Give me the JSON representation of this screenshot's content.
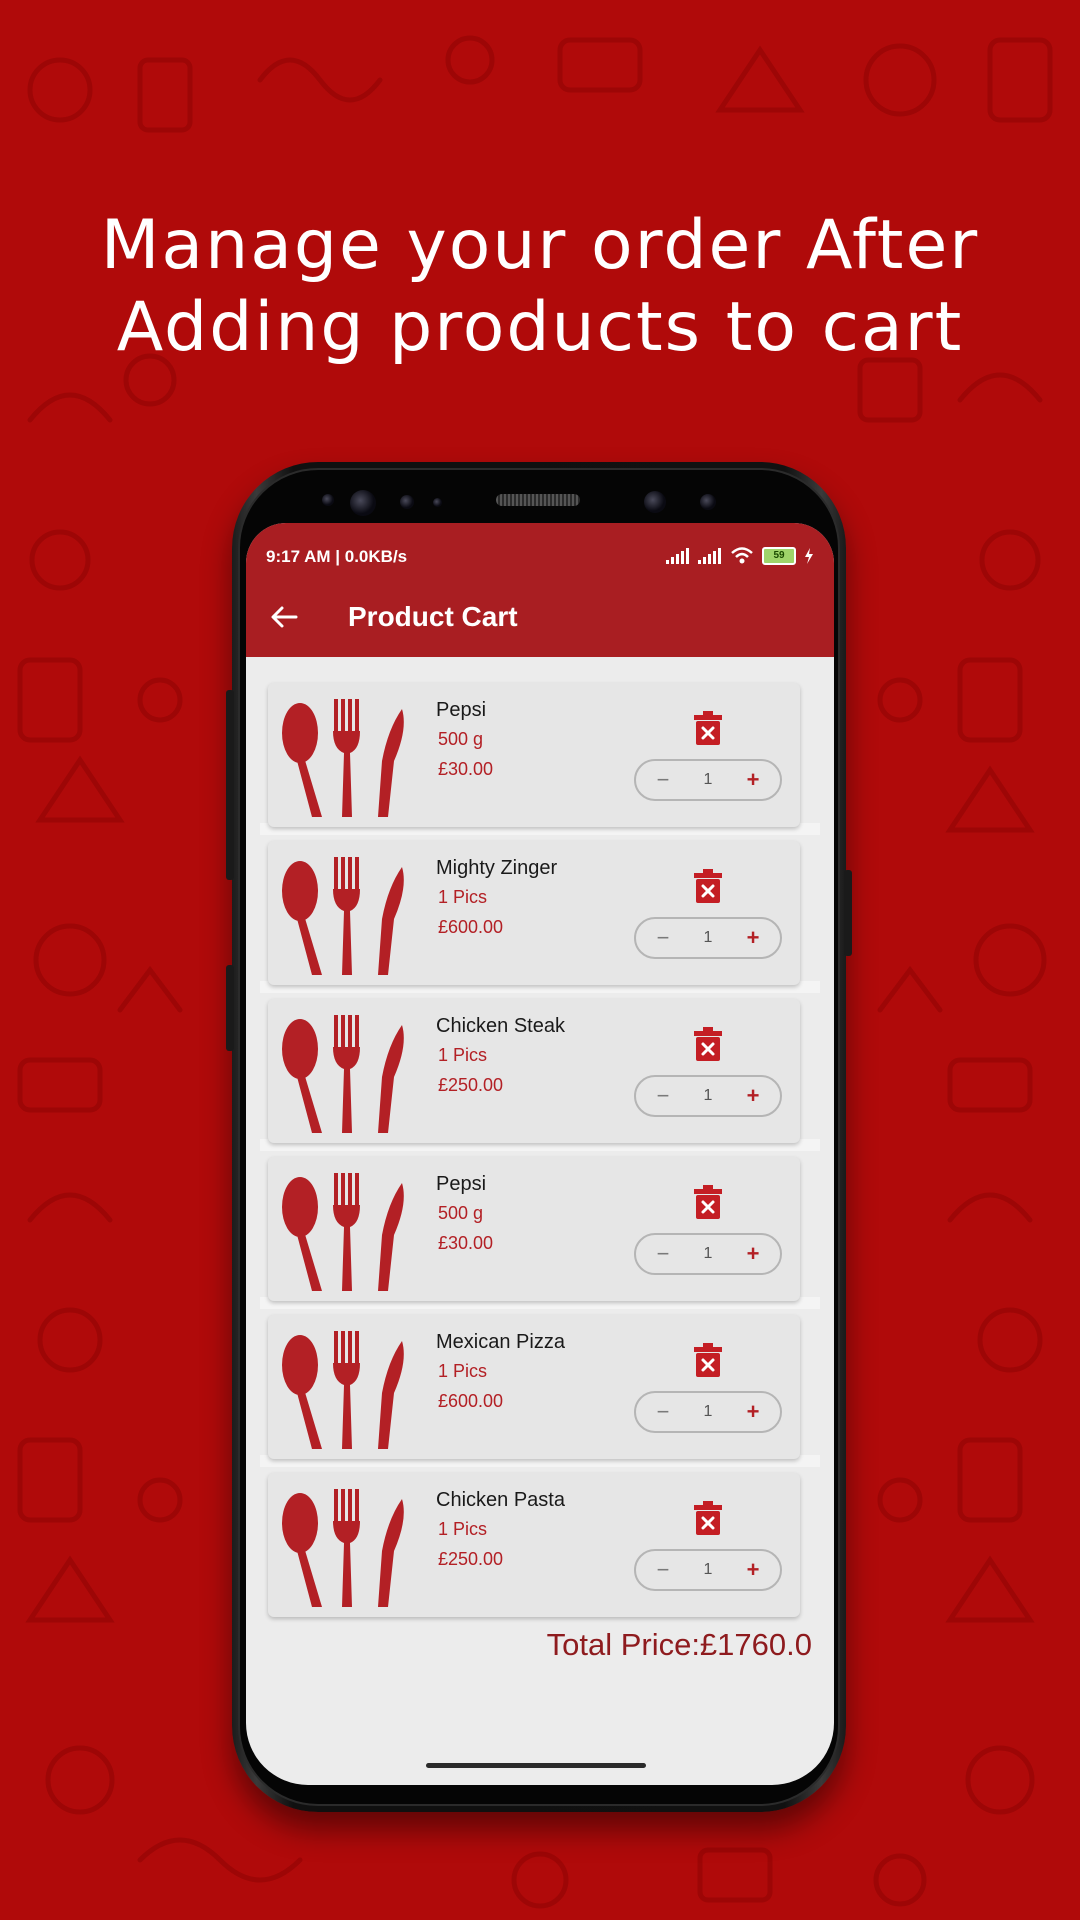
{
  "headline": {
    "line1": "Manage your order After",
    "line2": "Adding products to cart"
  },
  "status": {
    "time": "9:17 AM | 0.0KB/s",
    "battery": "59"
  },
  "appbar": {
    "title": "Product Cart"
  },
  "items": [
    {
      "name": "Pepsi",
      "qty": "500 g",
      "price": "£30.00",
      "count": "1"
    },
    {
      "name": "Mighty Zinger",
      "qty": "1 Pics",
      "price": "£600.00",
      "count": "1"
    },
    {
      "name": "Chicken Steak",
      "qty": "1 Pics",
      "price": "£250.00",
      "count": "1"
    },
    {
      "name": "Pepsi",
      "qty": "500 g",
      "price": "£30.00",
      "count": "1"
    },
    {
      "name": "Mexican Pizza",
      "qty": "1 Pics",
      "price": "£600.00",
      "count": "1"
    },
    {
      "name": "Chicken Pasta",
      "qty": "1 Pics",
      "price": "£250.00",
      "count": "1"
    }
  ],
  "stepper": {
    "minus": "−",
    "plus": "+"
  },
  "total": "Total Price:£1760.0",
  "colors": {
    "background": "#b00a0a",
    "accent": "#a91e22",
    "price": "#b32025"
  },
  "icons": {
    "back": "arrow-left-icon",
    "delete": "trash-icon",
    "product": "utensils-icon"
  }
}
